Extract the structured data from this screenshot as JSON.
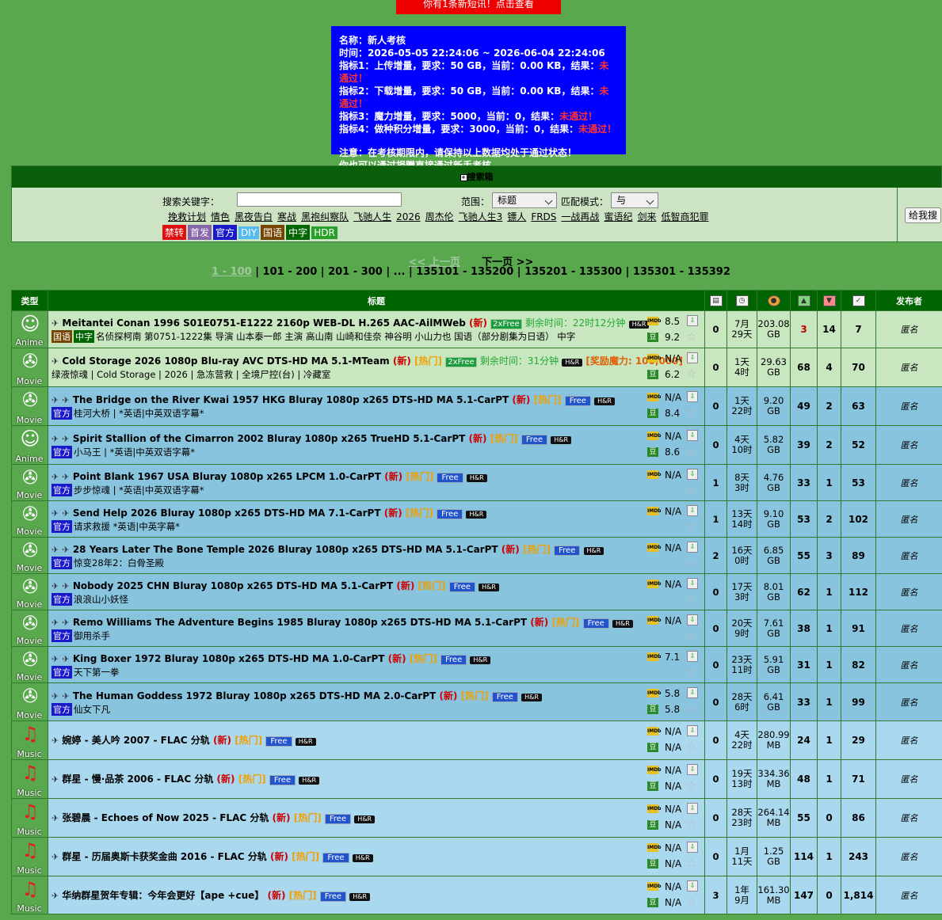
{
  "notice": {
    "text": "你有1条新短讯！点击查看"
  },
  "exam": {
    "name": "名称：新人考核",
    "time": "时间：2026-05-05 22:24:06 ~ 2026-06-04 22:24:06",
    "items": [
      {
        "text": "指标1：上传增量，要求：50 GB，当前：0.00 KB，结果：",
        "result": "未通过！"
      },
      {
        "text": "指标2：下载增量，要求：50 GB，当前：0.00 KB，结果：",
        "result": "未通过！"
      },
      {
        "text": "指标3：魔力增量，要求：5000，当前：0，结果：",
        "result": "未通过！"
      },
      {
        "text": "指标4：做种积分增量，要求：3000，当前：0，结果：",
        "result": "未通过！"
      }
    ],
    "note1": "注意：在考核期限内，请保持以上数据均处于通过状态！",
    "note2": "你也可以通过捐赠直接通过新手考核。"
  },
  "search": {
    "title": "搜索箱",
    "keyword_label": "搜索关键字：",
    "scope_label": "范围：",
    "scope_value": "标题",
    "mode_label": "匹配模式：",
    "mode_value": "与",
    "button": "给我搜",
    "hot": [
      "挽救计划",
      "情色",
      "黑夜告白",
      "寒战",
      "黑袍纠察队",
      "飞驰人生",
      "2026",
      "周杰伦",
      "飞驰人生3",
      "镖人",
      "FRDS",
      "一战再战",
      "蜜语纪",
      "剑来",
      "低智商犯罪"
    ],
    "tags": [
      {
        "label": "禁转",
        "color": "#e01010"
      },
      {
        "label": "首发",
        "color": "#8866aa"
      },
      {
        "label": "官方",
        "color": "#1a1acc"
      },
      {
        "label": "DIY",
        "color": "#55bbee"
      },
      {
        "label": "国语",
        "color": "#774400"
      },
      {
        "label": "中字",
        "color": "#006600"
      },
      {
        "label": "HDR",
        "color": "#2aa02a"
      }
    ]
  },
  "pager": {
    "prev": "<< 上一页",
    "next": "下一页 >>",
    "current": "1 - 100",
    "pages": [
      "101 - 200",
      "201 - 300",
      "...",
      "135101 - 135200",
      "135201 - 135300",
      "135301 - 135392"
    ]
  },
  "table": {
    "headers": {
      "type": "类型",
      "title": "标题",
      "uploader": "发布者"
    },
    "rows": [
      {
        "cat": "Anime",
        "glyph": "☺",
        "bg": "r1",
        "pins": 1,
        "title": "Meitantei Conan 1996 S01E0751-E1222 2160p WEB-DL H.265 AAC-AilMWeb",
        "new": "(新)",
        "hot": "",
        "x2": "2xFree",
        "free": "",
        "remain": "剩余时间：22时12分钟",
        "hr": true,
        "reward": "",
        "tags": [
          "国语",
          "中字"
        ],
        "sub": "名侦探柯南 第0751-1222集 导演 山本泰一郎 主演 高山南 山崎和佳奈 神谷明 小山力也 国语（部分剧集为日语） 中字",
        "imdb": "8.5",
        "douban": "9.2",
        "comments": "0",
        "age": "7月\n29天",
        "size": "203.08\nGB",
        "seed": "3",
        "seedRed": true,
        "leech": "14",
        "done": "7",
        "uploader": "匿名"
      },
      {
        "cat": "Movie",
        "glyph": "✇",
        "bg": "r1",
        "pins": 1,
        "title": "Cold Storage 2026 1080p Blu-ray AVC DTS-HD MA 5.1-MTeam",
        "new": "(新)",
        "hot": "[热门]",
        "x2": "2xFree",
        "free": "",
        "remain": "剩余时间：31分钟",
        "hr": true,
        "reward": "[奖励魔力: 100,000]",
        "tags": [],
        "sub": "绿液惊魂 | Cold Storage | 2026 | 急冻营救 | 全境尸控(台) | 冷藏室",
        "imdb": "N/A",
        "douban": "6.2",
        "comments": "0",
        "age": "1天\n4时",
        "size": "29.63\nGB",
        "seed": "68",
        "seedRed": false,
        "leech": "4",
        "done": "70",
        "uploader": "匿名"
      },
      {
        "cat": "Movie",
        "glyph": "✇",
        "bg": "r2",
        "pins": 2,
        "title": "The Bridge on the River Kwai 1957 HKG Bluray 1080p x265 DTS-HD MA 5.1-CarPT",
        "new": "(新)",
        "hot": "[热门]",
        "x2": "",
        "free": "Free",
        "remain": "",
        "hr": true,
        "reward": "",
        "tags": [
          "官方"
        ],
        "sub": "桂河大桥 | *英语|中英双语字幕*",
        "imdb": "N/A",
        "douban": "8.4",
        "comments": "0",
        "age": "1天\n22时",
        "size": "9.20\nGB",
        "seed": "49",
        "seedRed": false,
        "leech": "2",
        "done": "63",
        "uploader": "匿名"
      },
      {
        "cat": "Anime",
        "glyph": "☺",
        "bg": "r2",
        "pins": 2,
        "title": "Spirit Stallion of the Cimarron 2002 Bluray 1080p x265 TrueHD 5.1-CarPT",
        "new": "(新)",
        "hot": "[热门]",
        "x2": "",
        "free": "Free",
        "remain": "",
        "hr": true,
        "reward": "",
        "tags": [
          "官方"
        ],
        "sub": "小马王 | *英语|中英双语字幕*",
        "imdb": "N/A",
        "douban": "8.6",
        "comments": "0",
        "age": "4天\n10时",
        "size": "5.82\nGB",
        "seed": "39",
        "seedRed": false,
        "leech": "2",
        "done": "52",
        "uploader": "匿名"
      },
      {
        "cat": "Movie",
        "glyph": "✇",
        "bg": "r2",
        "pins": 2,
        "title": "Point Blank 1967 USA Bluray 1080p x265 LPCM 1.0-CarPT",
        "new": "(新)",
        "hot": "[热门]",
        "x2": "",
        "free": "Free",
        "remain": "",
        "hr": true,
        "reward": "",
        "tags": [
          "官方"
        ],
        "sub": "步步惊魂 | *英语|中英双语字幕*",
        "imdb": "N/A",
        "douban": "",
        "comments": "1",
        "age": "8天\n3时",
        "size": "4.76\nGB",
        "seed": "33",
        "seedRed": false,
        "leech": "1",
        "done": "53",
        "uploader": "匿名"
      },
      {
        "cat": "Movie",
        "glyph": "✇",
        "bg": "r2",
        "pins": 2,
        "title": "Send Help 2026 Bluray 1080p x265 DTS-HD MA 7.1-CarPT",
        "new": "(新)",
        "hot": "[热门]",
        "x2": "",
        "free": "Free",
        "remain": "",
        "hr": true,
        "reward": "",
        "tags": [
          "官方"
        ],
        "sub": "请求救援 *英语|中英字幕*",
        "imdb": "N/A",
        "douban": "",
        "comments": "1",
        "age": "13天\n14时",
        "size": "9.10\nGB",
        "seed": "53",
        "seedRed": false,
        "leech": "2",
        "done": "102",
        "uploader": "匿名"
      },
      {
        "cat": "Movie",
        "glyph": "✇",
        "bg": "r2",
        "pins": 2,
        "title": "28 Years Later The Bone Temple 2026 Bluray 1080p x265 DTS-HD MA 5.1-CarPT",
        "new": "(新)",
        "hot": "[热门]",
        "x2": "",
        "free": "Free",
        "remain": "",
        "hr": true,
        "reward": "",
        "tags": [
          "官方"
        ],
        "sub": "惊变28年2：白骨圣殿",
        "imdb": "N/A",
        "douban": "",
        "comments": "2",
        "age": "16天\n0时",
        "size": "6.85\nGB",
        "seed": "55",
        "seedRed": false,
        "leech": "3",
        "done": "89",
        "uploader": "匿名"
      },
      {
        "cat": "Movie",
        "glyph": "✇",
        "bg": "r2",
        "pins": 2,
        "title": "Nobody 2025 CHN Bluray 1080p x265 DTS-HD MA 5.1-CarPT",
        "new": "(新)",
        "hot": "[热门]",
        "x2": "",
        "free": "Free",
        "remain": "",
        "hr": true,
        "reward": "",
        "tags": [
          "官方"
        ],
        "sub": "浪浪山小妖怪",
        "imdb": "N/A",
        "douban": "",
        "comments": "0",
        "age": "17天\n3时",
        "size": "8.01\nGB",
        "seed": "62",
        "seedRed": false,
        "leech": "1",
        "done": "112",
        "uploader": "匿名"
      },
      {
        "cat": "Movie",
        "glyph": "✇",
        "bg": "r2",
        "pins": 2,
        "title": "Remo Williams The Adventure Begins 1985 Bluray 1080p x265 DTS-HD MA 5.1-CarPT",
        "new": "(新)",
        "hot": "[热门]",
        "x2": "",
        "free": "Free",
        "remain": "",
        "hr": true,
        "reward": "",
        "tags": [
          "官方"
        ],
        "sub": "御用杀手",
        "imdb": "N/A",
        "douban": "",
        "comments": "0",
        "age": "20天\n9时",
        "size": "7.61\nGB",
        "seed": "38",
        "seedRed": false,
        "leech": "1",
        "done": "91",
        "uploader": "匿名"
      },
      {
        "cat": "Movie",
        "glyph": "✇",
        "bg": "r2",
        "pins": 2,
        "title": "King Boxer 1972 Bluray 1080p x265 DTS-HD MA 1.0-CarPT",
        "new": "(新)",
        "hot": "[热门]",
        "x2": "",
        "free": "Free",
        "remain": "",
        "hr": true,
        "reward": "",
        "tags": [
          "官方"
        ],
        "sub": "天下第一拳",
        "imdb": "7.1",
        "douban": "",
        "comments": "0",
        "age": "23天\n11时",
        "size": "5.91\nGB",
        "seed": "31",
        "seedRed": false,
        "leech": "1",
        "done": "82",
        "uploader": "匿名"
      },
      {
        "cat": "Movie",
        "glyph": "✇",
        "bg": "r2",
        "pins": 2,
        "title": "The Human Goddess 1972 Bluray 1080p x265 DTS-HD MA 2.0-CarPT",
        "new": "(新)",
        "hot": "[热门]",
        "x2": "",
        "free": "Free",
        "remain": "",
        "hr": true,
        "reward": "",
        "tags": [
          "官方"
        ],
        "sub": "仙女下凡",
        "imdb": "5.8",
        "douban": "5.8",
        "comments": "0",
        "age": "28天\n6时",
        "size": "6.41\nGB",
        "seed": "33",
        "seedRed": false,
        "leech": "1",
        "done": "99",
        "uploader": "匿名"
      },
      {
        "cat": "Music",
        "glyph": "♫",
        "bg": "r3",
        "pins": 1,
        "title": "婉婷 - 美人吟 2007 - FLAC 分轨",
        "new": "(新)",
        "hot": "[热门]",
        "x2": "",
        "free": "Free",
        "remain": "",
        "hr": true,
        "reward": "",
        "tags": [],
        "sub": "",
        "imdb": "N/A",
        "douban": "N/A",
        "comments": "0",
        "age": "4天\n22时",
        "size": "280.99\nMB",
        "seed": "24",
        "seedRed": false,
        "leech": "1",
        "done": "29",
        "uploader": "匿名"
      },
      {
        "cat": "Music",
        "glyph": "♫",
        "bg": "r3",
        "pins": 1,
        "title": "群星 - 慢·品茶 2006 - FLAC 分轨",
        "new": "(新)",
        "hot": "[热门]",
        "x2": "",
        "free": "Free",
        "remain": "",
        "hr": true,
        "reward": "",
        "tags": [],
        "sub": "",
        "imdb": "N/A",
        "douban": "N/A",
        "comments": "0",
        "age": "19天\n13时",
        "size": "334.36\nMB",
        "seed": "48",
        "seedRed": false,
        "leech": "1",
        "done": "71",
        "uploader": "匿名"
      },
      {
        "cat": "Music",
        "glyph": "♫",
        "bg": "r3",
        "pins": 1,
        "title": "张碧晨 - Echoes of Now 2025 - FLAC 分轨",
        "new": "(新)",
        "hot": "[热门]",
        "x2": "",
        "free": "Free",
        "remain": "",
        "hr": true,
        "reward": "",
        "tags": [],
        "sub": "",
        "imdb": "N/A",
        "douban": "N/A",
        "comments": "0",
        "age": "28天\n23时",
        "size": "264.14\nMB",
        "seed": "55",
        "seedRed": false,
        "leech": "0",
        "done": "86",
        "uploader": "匿名"
      },
      {
        "cat": "Music",
        "glyph": "♫",
        "bg": "r3",
        "pins": 1,
        "title": "群星 - 历届奥斯卡获奖金曲 2016 - FLAC 分轨",
        "new": "(新)",
        "hot": "[热门]",
        "x2": "",
        "free": "Free",
        "remain": "",
        "hr": true,
        "reward": "",
        "tags": [],
        "sub": "",
        "imdb": "N/A",
        "douban": "N/A",
        "comments": "0",
        "age": "1月\n11天",
        "size": "1.25\nGB",
        "seed": "114",
        "seedRed": false,
        "leech": "1",
        "done": "243",
        "uploader": "匿名"
      },
      {
        "cat": "Music",
        "glyph": "♫",
        "bg": "r3",
        "pins": 1,
        "title": "华纳群星贺年专辑：今年会更好【ape +cue】",
        "new": "(新)",
        "hot": "[热门]",
        "x2": "",
        "free": "Free",
        "remain": "",
        "hr": true,
        "reward": "",
        "tags": [],
        "sub": "",
        "imdb": "N/A",
        "douban": "N/A",
        "comments": "3",
        "age": "1年\n9月",
        "size": "161.30\nMB",
        "seed": "147",
        "seedRed": false,
        "leech": "0",
        "done": "1,814",
        "uploader": "匿名"
      }
    ]
  }
}
